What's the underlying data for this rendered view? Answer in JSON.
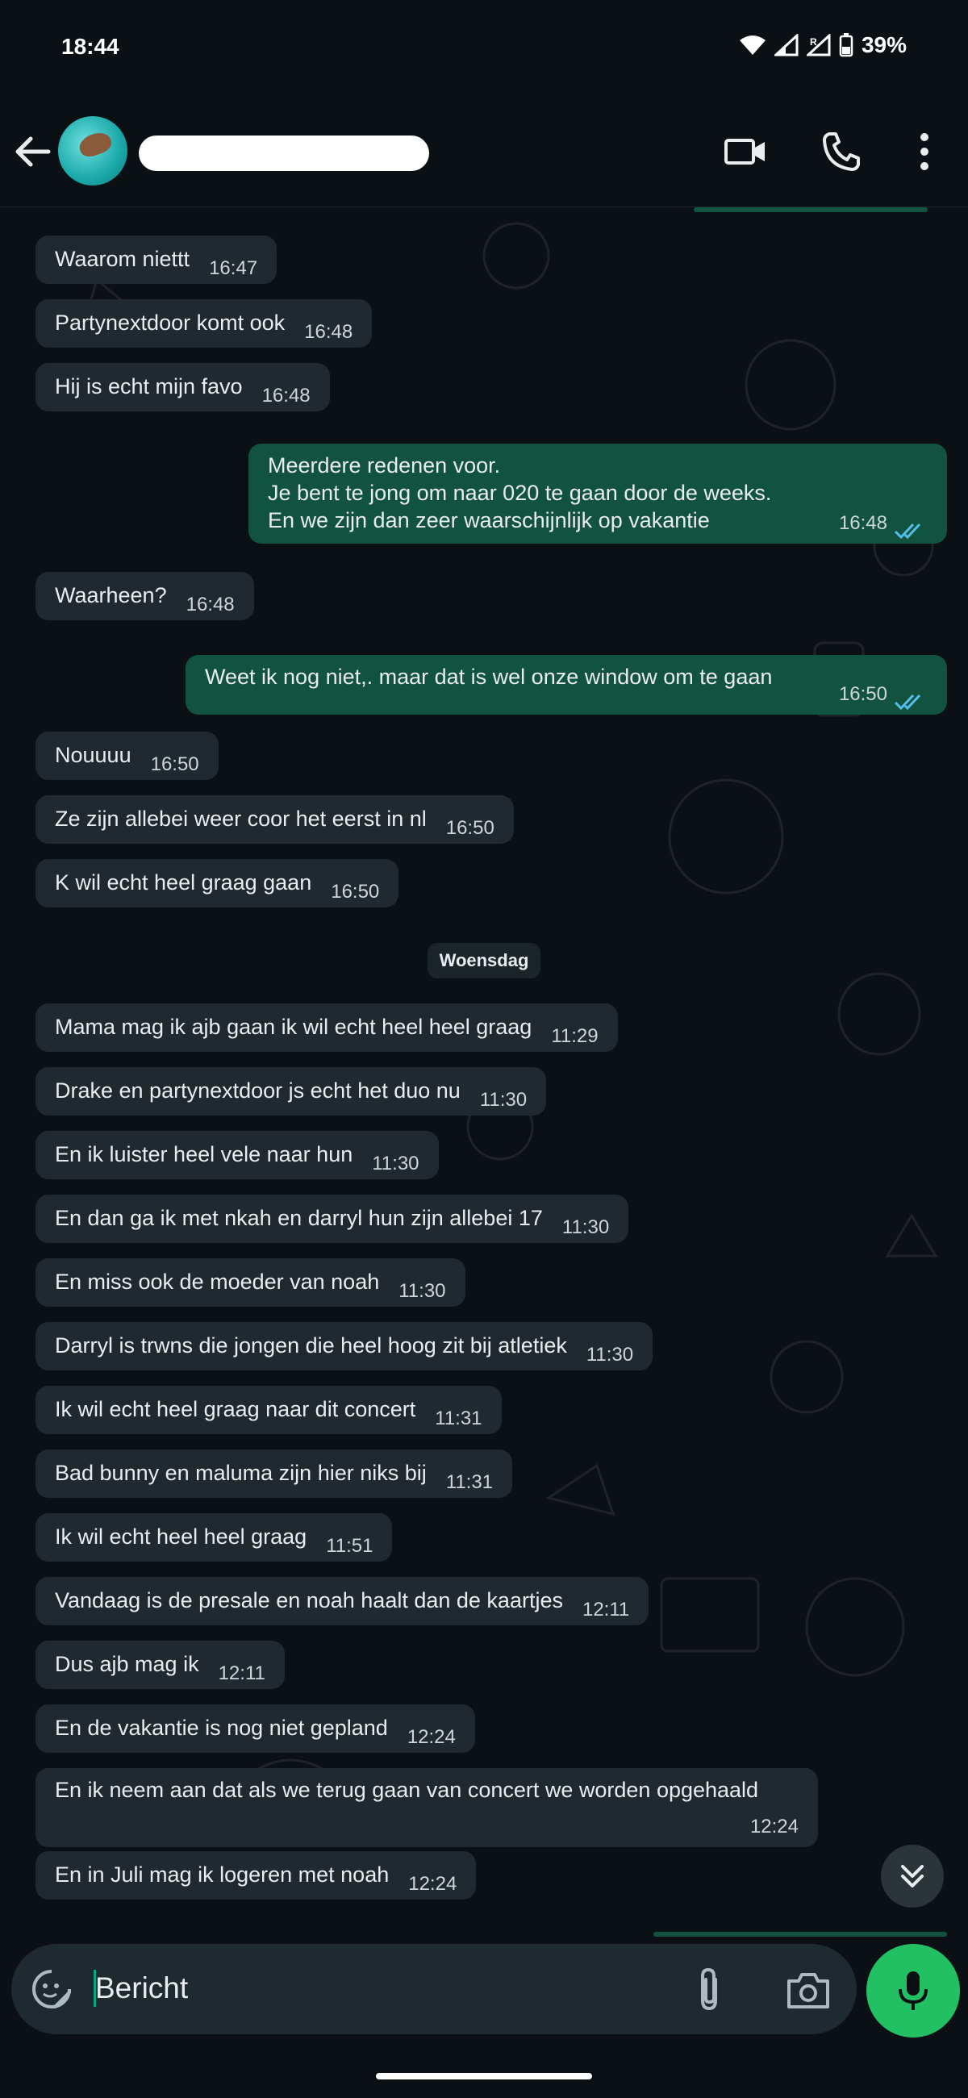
{
  "status": {
    "time": "18:44",
    "battery": "39%"
  },
  "header": {
    "contact_name_redacted": ""
  },
  "day_separator": "Woensdag",
  "messages": [
    {
      "dir": "in",
      "text": "Waarom niettt",
      "time": "16:47"
    },
    {
      "dir": "in",
      "text": "Partynextdoor komt ook",
      "time": "16:48"
    },
    {
      "dir": "in",
      "text": "Hij is echt mijn favo",
      "time": "16:48"
    },
    {
      "dir": "out",
      "text": "Meerdere redenen voor.\nJe bent te jong om naar 020 te gaan door de weeks.\nEn we zijn dan zeer waarschijnlijk op vakantie",
      "time": "16:48"
    },
    {
      "dir": "in",
      "text": "Waarheen?",
      "time": "16:48"
    },
    {
      "dir": "out",
      "text": "Weet ik nog niet,. maar dat is wel onze window om te gaan",
      "time": "16:50"
    },
    {
      "dir": "in",
      "text": "Nouuuu",
      "time": "16:50"
    },
    {
      "dir": "in",
      "text": "Ze zijn allebei weer coor het eerst in nl",
      "time": "16:50"
    },
    {
      "dir": "in",
      "text": "K wil echt heel graag gaan",
      "time": "16:50"
    },
    {
      "dir": "in",
      "text": "Mama mag ik ajb gaan ik wil echt heel heel graag",
      "time": "11:29"
    },
    {
      "dir": "in",
      "text": "Drake en partynextdoor js echt het duo nu",
      "time": "11:30"
    },
    {
      "dir": "in",
      "text": "En ik luister heel vele naar hun",
      "time": "11:30"
    },
    {
      "dir": "in",
      "text": "En dan ga ik met nkah en darryl hun zijn allebei 17",
      "time": "11:30"
    },
    {
      "dir": "in",
      "text": "En miss ook de moeder van noah",
      "time": "11:30"
    },
    {
      "dir": "in",
      "text": "Darryl is trwns die jongen die heel hoog zit bij atletiek",
      "time": "11:30"
    },
    {
      "dir": "in",
      "text": "Ik wil echt heel graag naar dit concert",
      "time": "11:31"
    },
    {
      "dir": "in",
      "text": "Bad bunny en maluma zijn hier niks bij",
      "time": "11:31"
    },
    {
      "dir": "in",
      "text": "Ik wil echt heel heel graag",
      "time": "11:51"
    },
    {
      "dir": "in",
      "text": "Vandaag is de presale en noah haalt dan de kaartjes",
      "time": "12:11"
    },
    {
      "dir": "in",
      "text": "Dus ajb mag ik",
      "time": "12:11"
    },
    {
      "dir": "in",
      "text": "En de vakantie is nog niet gepland",
      "time": "12:24"
    },
    {
      "dir": "in",
      "text": "En ik neem aan dat als we terug gaan van concert we worden opgehaald",
      "time": "12:24"
    },
    {
      "dir": "in",
      "text": "En in Juli mag ik logeren met noah",
      "time": "12:24"
    }
  ],
  "composer": {
    "placeholder": "Bericht"
  },
  "colors": {
    "incoming": "#20292f",
    "outgoing": "#12533f",
    "accent": "#21c063",
    "read_ticks": "#53bdeb"
  }
}
